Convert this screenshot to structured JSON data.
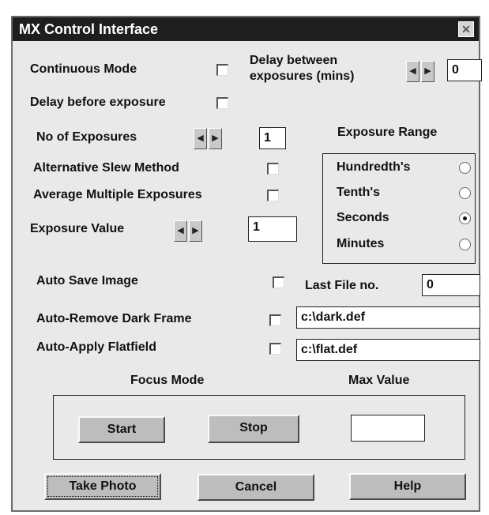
{
  "window": {
    "title": "MX Control Interface",
    "close_glyph": "✕"
  },
  "continuous_mode": {
    "label": "Continuous Mode",
    "checked": false
  },
  "delay_between": {
    "label_line1": "Delay between",
    "label_line2": "exposures (mins)",
    "value": "0"
  },
  "delay_before": {
    "label": "Delay before exposure",
    "checked": false
  },
  "no_of_exposures": {
    "label": "No of Exposures",
    "value": "1"
  },
  "alt_slew": {
    "label": "Alternative Slew Method",
    "checked": false
  },
  "avg_multi": {
    "label": "Average Multiple Exposures",
    "checked": false
  },
  "exposure_value": {
    "label": "Exposure Value",
    "value": "1"
  },
  "exposure_range": {
    "title": "Exposure Range",
    "options": [
      {
        "label": "Hundredth's",
        "selected": false
      },
      {
        "label": "Tenth's",
        "selected": false
      },
      {
        "label": "Seconds",
        "selected": true
      },
      {
        "label": "Minutes",
        "selected": false
      }
    ]
  },
  "auto_save": {
    "label": "Auto Save Image",
    "checked": false
  },
  "last_file": {
    "label": "Last File no.",
    "value": "0"
  },
  "dark_frame": {
    "label": "Auto-Remove Dark Frame",
    "checked": false,
    "path": "c:\\dark.def"
  },
  "flatfield": {
    "label": "Auto-Apply Flatfield",
    "checked": false,
    "path": "c:\\flat.def"
  },
  "focus": {
    "title": "Focus Mode",
    "max_label": "Max Value",
    "start": "Start",
    "stop": "Stop",
    "max_value": ""
  },
  "spinner": {
    "left": "◀",
    "right": "▶"
  },
  "buttons": {
    "take_photo": "Take Photo",
    "cancel": "Cancel",
    "help": "Help"
  }
}
